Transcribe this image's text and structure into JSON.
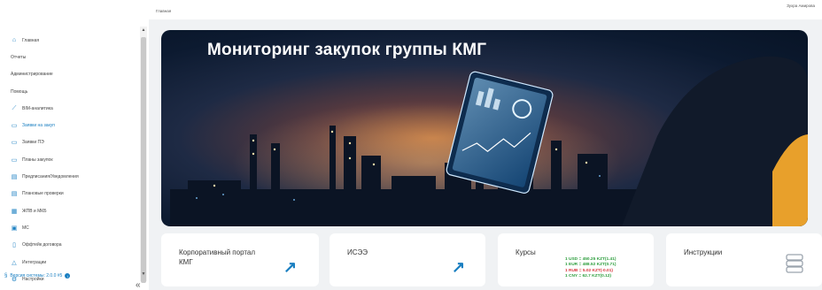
{
  "header": {
    "breadcrumb": "Главная",
    "user": "Зухра Амирова"
  },
  "sidebar": {
    "items": [
      {
        "label": "Главная",
        "icon": "home-icon",
        "glyph": "⌂"
      },
      {
        "label": "Отчеты",
        "icon": "",
        "glyph": ""
      },
      {
        "label": "Администрирование",
        "icon": "",
        "glyph": ""
      },
      {
        "label": "Помощь",
        "icon": "",
        "glyph": ""
      },
      {
        "label": "BIM-аналитика",
        "icon": "chart-line-icon",
        "glyph": "⟋"
      },
      {
        "label": "Заявки на закуп",
        "icon": "card-icon",
        "glyph": "▭"
      },
      {
        "label": "Заявки ПЭ",
        "icon": "card-icon",
        "glyph": "▭"
      },
      {
        "label": "Планы закупок",
        "icon": "card-icon",
        "glyph": "▭"
      },
      {
        "label": "Предписания/Уведомления",
        "icon": "list-box-icon",
        "glyph": "▤"
      },
      {
        "label": "Плановые проверки",
        "icon": "doc-check-icon",
        "glyph": "▤"
      },
      {
        "label": "ЖПВ и МКБ",
        "icon": "table-icon",
        "glyph": "▦"
      },
      {
        "label": "МС",
        "icon": "box-icon",
        "glyph": "▣"
      },
      {
        "label": "Оффтейк договора",
        "icon": "contract-icon",
        "glyph": "▯"
      },
      {
        "label": "Интеграции",
        "icon": "triangle-icon",
        "glyph": "△"
      },
      {
        "label": "Настройки",
        "icon": "gear-icon",
        "glyph": "⚙"
      }
    ],
    "version": "Версия системы: 2.0.0 #5"
  },
  "hero": {
    "title": "Мониторинг закупок группы КМГ"
  },
  "tiles": {
    "portal": {
      "title": "Корпоративный портал КМГ"
    },
    "isee": {
      "title": "ИСЭЭ"
    },
    "rates": {
      "title": "Курсы",
      "lines": [
        {
          "text": "1 USD = 450.25 KZT(1.41)",
          "color": "#2e9e3e"
        },
        {
          "text": "1 EUR = 488.52 KZT(0.71)",
          "color": "#2e9e3e"
        },
        {
          "text": "1 RUB = 5.02 KZT(-0.01)",
          "color": "#d9363e"
        },
        {
          "text": "1 CNY = 62.7 KZT(0.12)",
          "color": "#2e9e3e"
        }
      ]
    },
    "instructions": {
      "title": "Инструкции"
    }
  },
  "colors": {
    "accent": "#1a7fc1",
    "up": "#2e9e3e",
    "down": "#d9363e"
  }
}
